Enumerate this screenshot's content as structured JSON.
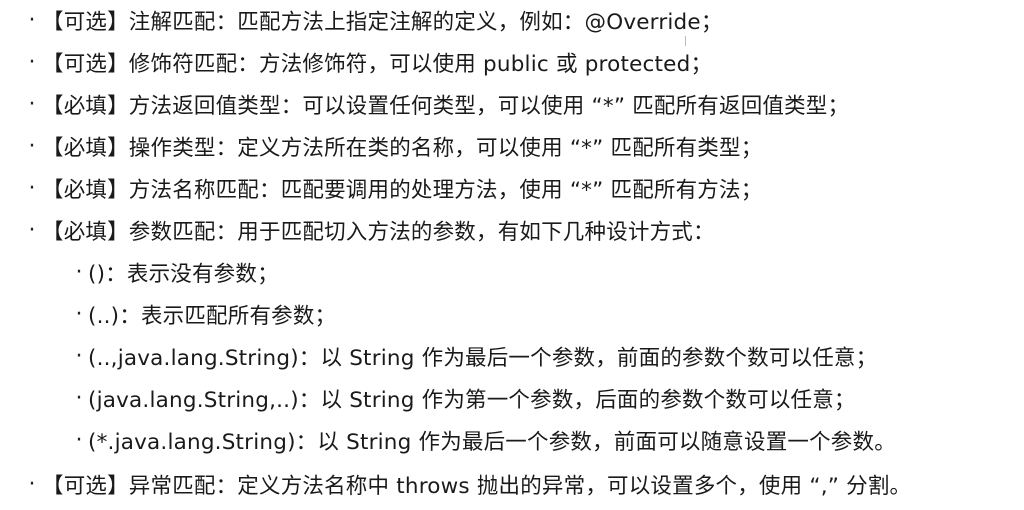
{
  "items": [
    {
      "bullet": "·",
      "text": "【可选】注解匹配：匹配方法上指定注解的定义，例如：@Override；"
    },
    {
      "bullet": "·",
      "text": "【可选】修饰符匹配：方法修饰符，可以使用 public 或 protected；"
    },
    {
      "bullet": "·",
      "text": "【必填】方法返回值类型：可以设置任何类型，可以使用 “*” 匹配所有返回值类型；"
    },
    {
      "bullet": "·",
      "text": "【必填】操作类型：定义方法所在类的名称，可以使用 “*” 匹配所有类型；"
    },
    {
      "bullet": "·",
      "text": "【必填】方法名称匹配：匹配要调用的处理方法，使用 “*” 匹配所有方法；"
    },
    {
      "bullet": "·",
      "text": "【必填】参数匹配：用于匹配切入方法的参数，有如下几种设计方式："
    },
    {
      "bullet": "·",
      "text": "()：表示没有参数；"
    },
    {
      "bullet": "·",
      "text": "(..)：表示匹配所有参数；"
    },
    {
      "bullet": "·",
      "text": "(..,java.lang.String)：以 String 作为最后一个参数，前面的参数个数可以任意；"
    },
    {
      "bullet": "·",
      "text": "(java.lang.String,..)：以 String 作为第一个参数，后面的参数个数可以任意；"
    },
    {
      "bullet": "·",
      "text": "(*.java.lang.String)：以 String 作为最后一个参数，前面可以随意设置一个参数。"
    },
    {
      "bullet": "·",
      "text": "【可选】异常匹配：定义方法名称中 throws 抛出的异常，可以设置多个，使用 “,” 分割。"
    }
  ]
}
